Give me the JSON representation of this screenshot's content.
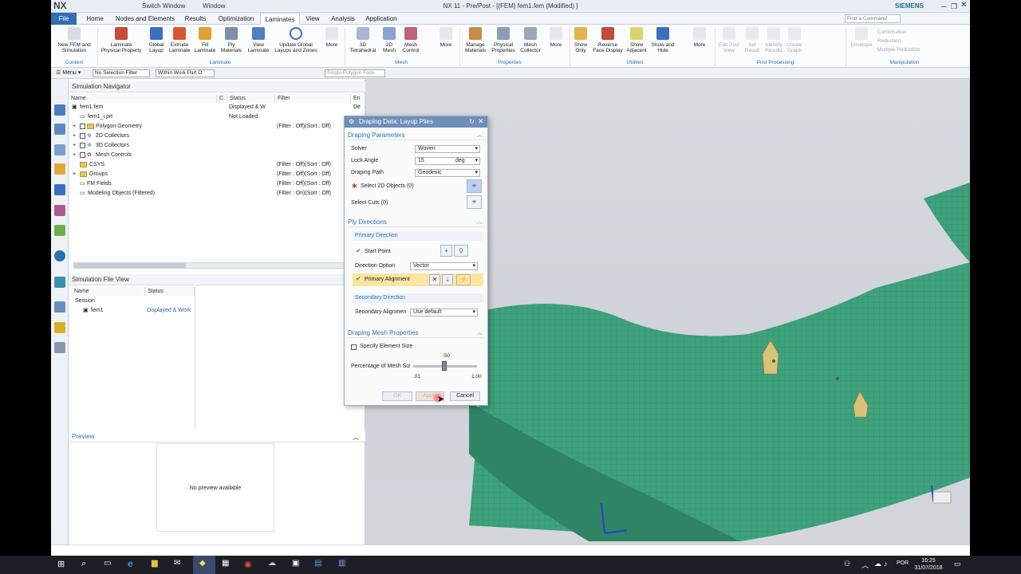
{
  "app": {
    "logo": "NX",
    "title": "NX 11 - Pre/Post - [(FEM) fem1.fem (Modified) ]",
    "brand": "SIEMENS",
    "switch_window": "Switch Window",
    "window": "Window",
    "find_command": "Find a Command"
  },
  "ribbon_tabs": [
    "File",
    "Home",
    "Nodes and Elements",
    "Results",
    "Optimization",
    "Laminates",
    "View",
    "Analysis",
    "Application"
  ],
  "ribbon_buttons": [
    {
      "label": "New FEM and Simulation",
      "group": "Context"
    },
    {
      "label": "Laminate Physical Property"
    },
    {
      "label": "Global Layup"
    },
    {
      "label": "Extrude Laminate"
    },
    {
      "label": "Fill Laminate"
    },
    {
      "label": "Ply Materials"
    },
    {
      "label": "View Laminate"
    },
    {
      "label": "Update Global Layups and Zones"
    },
    {
      "label": "More"
    },
    {
      "label": "3D Tetrahedral"
    },
    {
      "label": "2D Mesh"
    },
    {
      "label": "Mesh Control"
    },
    {
      "label": "More"
    },
    {
      "label": "Manage Materials"
    },
    {
      "label": "Physical Properties"
    },
    {
      "label": "Mesh Collector"
    },
    {
      "label": "More"
    },
    {
      "label": "Show Only"
    },
    {
      "label": "Reverse Face Display"
    },
    {
      "label": "Show Adjacent"
    },
    {
      "label": "Show and Hide"
    },
    {
      "label": "More"
    },
    {
      "label": "Edit Post View"
    },
    {
      "label": "Set Result"
    },
    {
      "label": "Identify Results"
    },
    {
      "label": "Create Graph"
    },
    {
      "label": "Envelope"
    }
  ],
  "ribbon_groups": [
    "Context",
    "Laminate",
    "Mesh",
    "Properties",
    "Utilities",
    "Post Processing",
    "Manipulation"
  ],
  "manipulation_items": [
    "Combination",
    "Reduction",
    "Multiple Reduction"
  ],
  "toolbar2": {
    "menu": "Menu",
    "selection_filter": "No Selection Filter",
    "scope": "Within Work Part O",
    "polygon_face": "Single Polygon Face"
  },
  "nav": {
    "title": "Simulation Navigator",
    "columns": [
      "Name",
      "C.",
      "Status",
      "Filter",
      "En"
    ],
    "rows": [
      {
        "name": "fem1.fem",
        "status": "Displayed & W",
        "filter": "",
        "en": "De"
      },
      {
        "name": "fem1_i.prt",
        "status": "Not Loaded",
        "filter": ""
      },
      {
        "name": "Polygon Geometry",
        "status": "",
        "filter": "(Filter : Off)(Sort : Off)"
      },
      {
        "name": "2D Collectors",
        "status": "",
        "filter": ""
      },
      {
        "name": "3D Collectors",
        "status": "",
        "filter": ""
      },
      {
        "name": "Mesh Controls",
        "status": "",
        "filter": ""
      },
      {
        "name": "CSYS",
        "status": "",
        "filter": "(Filter : Off)(Sort : Off)"
      },
      {
        "name": "Groups",
        "status": "",
        "filter": "(Filter : Off)(Sort : Off)"
      },
      {
        "name": "FM Fields",
        "status": "",
        "filter": "(Filter : Off)(Sort : Off)"
      },
      {
        "name": "Modeling Objects (Filtered)",
        "status": "",
        "filter": "(Filter : On)(Sort : Off)"
      }
    ]
  },
  "file_view": {
    "title": "Simulation File View",
    "columns": [
      "Name",
      "Status"
    ],
    "rows": [
      {
        "name": "Session",
        "status": ""
      },
      {
        "name": "fem1",
        "status": "Displayed & Work"
      }
    ]
  },
  "preview": {
    "title": "Preview",
    "empty": "No preview available"
  },
  "dialog": {
    "title": "Draping Data: Layup Plies",
    "sec_params": "Draping Parameters",
    "solver_label": "Solver",
    "solver_value": "Woven",
    "lock_label": "Lock Angle",
    "lock_value": "15",
    "lock_unit": "deg",
    "path_label": "Draping Path",
    "path_value": "Geodesic",
    "select2d": "Select 2D Objects (0)",
    "select_cuts": "Select Cuts (0)",
    "sec_ply": "Ply Directions",
    "primary_dir": "Primary Direction",
    "start_point": "Start Point",
    "dir_option_label": "Direction Option",
    "dir_option_value": "Vector",
    "primary_align": "Primary Alignment",
    "secondary_dir": "Secondary Direction",
    "secondary_align_label": "Secondary Alignmen",
    "secondary_align_value": "Use default",
    "sec_mesh": "Draping Mesh Properties",
    "specify_elem": "Specify Element Size",
    "pct_label": "Percentage of Mesh Siz",
    "slider_value": ".50",
    "slider_min": ".01",
    "slider_max": "1.00",
    "ok": "OK",
    "apply": "Apply",
    "cancel": "Cancel"
  },
  "status": {
    "time": "16:25",
    "date": "31/07/2018",
    "lang": "POR"
  },
  "colors": {
    "ribbon_blue": "#2f6fb5",
    "mesh_green": "#3ea27c",
    "dialog_header": "#6d8fb8"
  }
}
